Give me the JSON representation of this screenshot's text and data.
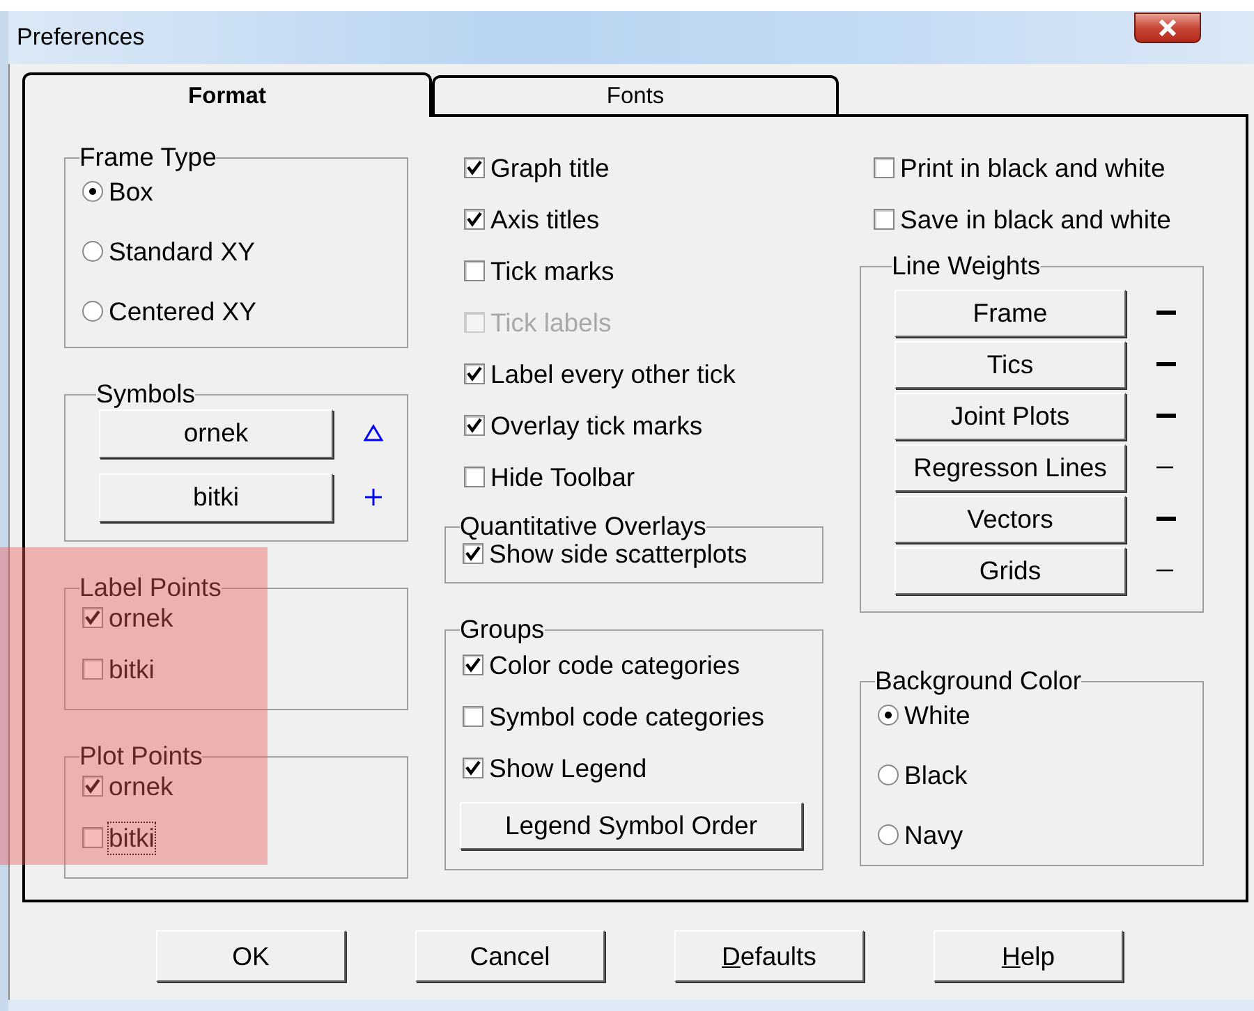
{
  "window": {
    "title": "Preferences"
  },
  "tabs": [
    {
      "label": "Format",
      "selected": true
    },
    {
      "label": "Fonts",
      "selected": false
    }
  ],
  "frame_type": {
    "title": "Frame Type",
    "options": [
      {
        "label": "Box",
        "selected": true
      },
      {
        "label": "Standard XY",
        "selected": false
      },
      {
        "label": "Centered XY",
        "selected": false
      }
    ]
  },
  "symbols": {
    "title": "Symbols",
    "items": [
      {
        "label": "ornek",
        "kind": "triangle"
      },
      {
        "label": "bitki",
        "kind": "plus"
      }
    ]
  },
  "label_points": {
    "title": "Label Points",
    "items": [
      {
        "label": "ornek",
        "checked": true,
        "focused": false
      },
      {
        "label": "bitki",
        "checked": false,
        "focused": false
      }
    ]
  },
  "plot_points": {
    "title": "Plot Points",
    "items": [
      {
        "label": "ornek",
        "checked": true,
        "focused": false
      },
      {
        "label": "bitki",
        "checked": false,
        "focused": true
      }
    ]
  },
  "display_options": [
    {
      "label": "Graph title",
      "checked": true,
      "disabled": false
    },
    {
      "label": "Axis titles",
      "checked": true,
      "disabled": false
    },
    {
      "label": "Tick marks",
      "checked": false,
      "disabled": false
    },
    {
      "label": "Tick labels",
      "checked": false,
      "disabled": true
    },
    {
      "label": "Label every other tick",
      "checked": true,
      "disabled": false
    },
    {
      "label": "Overlay tick marks",
      "checked": true,
      "disabled": false
    },
    {
      "label": "Hide Toolbar",
      "checked": false,
      "disabled": false
    }
  ],
  "quantitative_overlays": {
    "title": "Quantitative Overlays",
    "items": [
      {
        "label": "Show side scatterplots",
        "checked": true
      }
    ]
  },
  "groups": {
    "title": "Groups",
    "items": [
      {
        "label": "Color code categories",
        "checked": true
      },
      {
        "label": "Symbol code categories",
        "checked": false
      },
      {
        "label": "Show Legend",
        "checked": true
      }
    ],
    "button": "Legend Symbol Order"
  },
  "color_options": [
    {
      "label": "Print in black and white",
      "checked": false
    },
    {
      "label": "Save in black and white",
      "checked": false
    }
  ],
  "line_weights": {
    "title": "Line Weights",
    "items": [
      {
        "label": "Frame",
        "kind": "thick"
      },
      {
        "label": "Tics",
        "kind": "thick"
      },
      {
        "label": "Joint Plots",
        "kind": "thick"
      },
      {
        "label": "Regresson Lines",
        "kind": "thin"
      },
      {
        "label": "Vectors",
        "kind": "thick"
      },
      {
        "label": "Grids",
        "kind": "thin"
      }
    ]
  },
  "background_color": {
    "title": "Background Color",
    "options": [
      {
        "label": "White",
        "selected": true
      },
      {
        "label": "Black",
        "selected": false
      },
      {
        "label": "Navy",
        "selected": false
      }
    ]
  },
  "buttons": [
    {
      "label": "OK"
    },
    {
      "label": "Cancel"
    },
    {
      "key": "D",
      "rest": "efaults"
    },
    {
      "key": "H",
      "rest": "elp"
    }
  ],
  "highlight": true
}
